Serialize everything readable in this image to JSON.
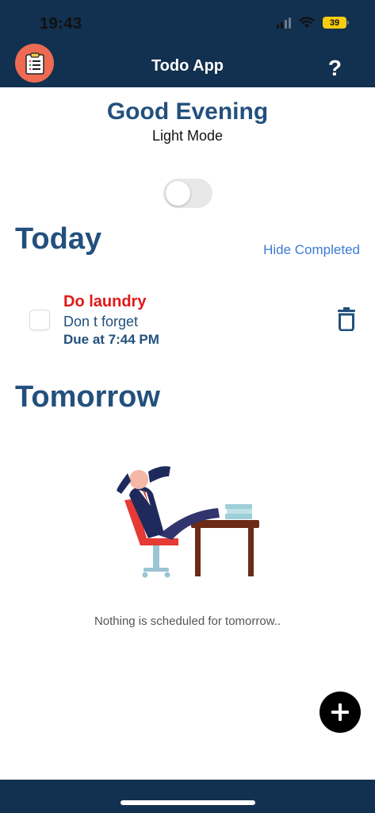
{
  "status_bar": {
    "time": "19:43",
    "battery": "39"
  },
  "header": {
    "title": "Todo App",
    "help_label": "?"
  },
  "greeting": {
    "title": "Good Evening",
    "mode": "Light Mode"
  },
  "today": {
    "title": "Today",
    "hide_completed": "Hide Completed",
    "tasks": [
      {
        "title": "Do laundry",
        "description": "Don t forget",
        "due": "Due at 7:44 PM"
      }
    ]
  },
  "tomorrow": {
    "title": "Tomorrow",
    "empty_message": "Nothing is scheduled for tomorrow.."
  },
  "fab": {
    "icon": "plus-icon"
  },
  "colors": {
    "primary": "#12304f",
    "heading": "#23507d",
    "task_title": "#e21818",
    "link": "#3b7bd4",
    "app_icon_bg": "#ee6a53",
    "battery": "#f6cc10"
  }
}
